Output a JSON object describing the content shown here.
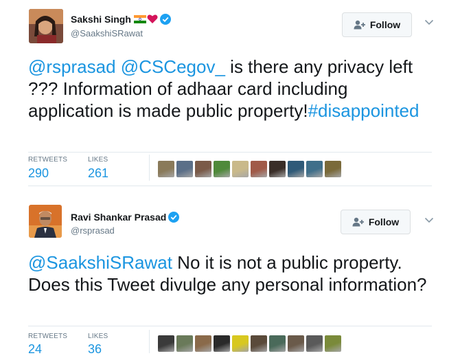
{
  "tweets": [
    {
      "author_name": "Sakshi Singh",
      "handle": "@SaakshiSRawat",
      "follow_label": "Follow",
      "text_segments": [
        {
          "text": "@rsprasad",
          "link": true
        },
        {
          "text": " ",
          "link": false
        },
        {
          "text": "@CSCegov_",
          "link": true
        },
        {
          "text": " is there any privacy left ??? Information of adhaar card including application is made public property!",
          "link": false
        },
        {
          "text": "#disappointed",
          "link": true
        }
      ],
      "retweets_label": "RETWEETS",
      "retweets_count": "290",
      "likes_label": "LIKES",
      "likes_count": "261",
      "liker_colors": [
        "#8a7a5a",
        "#5b6f88",
        "#7a5a48",
        "#4f8a3a",
        "#c9b98a",
        "#a05a48",
        "#3a2e28",
        "#2f5a78",
        "#3f6f8a",
        "#7a6a3a"
      ]
    },
    {
      "author_name": "Ravi Shankar Prasad",
      "handle": "@rsprasad",
      "follow_label": "Follow",
      "text_segments": [
        {
          "text": "@SaakshiSRawat",
          "link": true
        },
        {
          "text": " No it is not a public property. Does this Tweet divulge any personal information?",
          "link": false
        }
      ],
      "retweets_label": "RETWEETS",
      "retweets_count": "24",
      "likes_label": "LIKES",
      "likes_count": "36",
      "liker_colors": [
        "#3a3a3a",
        "#6a7a5a",
        "#8a6a4a",
        "#2a2a2a",
        "#d8c820",
        "#5a4a3a",
        "#4a6a5a",
        "#6a5a4a",
        "#5a5a5a",
        "#7a8a3a"
      ]
    }
  ],
  "colors": {
    "link": "#1b95e0",
    "text": "#14171a",
    "secondary": "#657786",
    "verified": "#1da1f2",
    "heart": "#d4145a"
  },
  "icons": [
    "verified-badge-icon",
    "india-flag-emoji",
    "red-heart-emoji",
    "add-user-icon",
    "chevron-down-icon"
  ]
}
